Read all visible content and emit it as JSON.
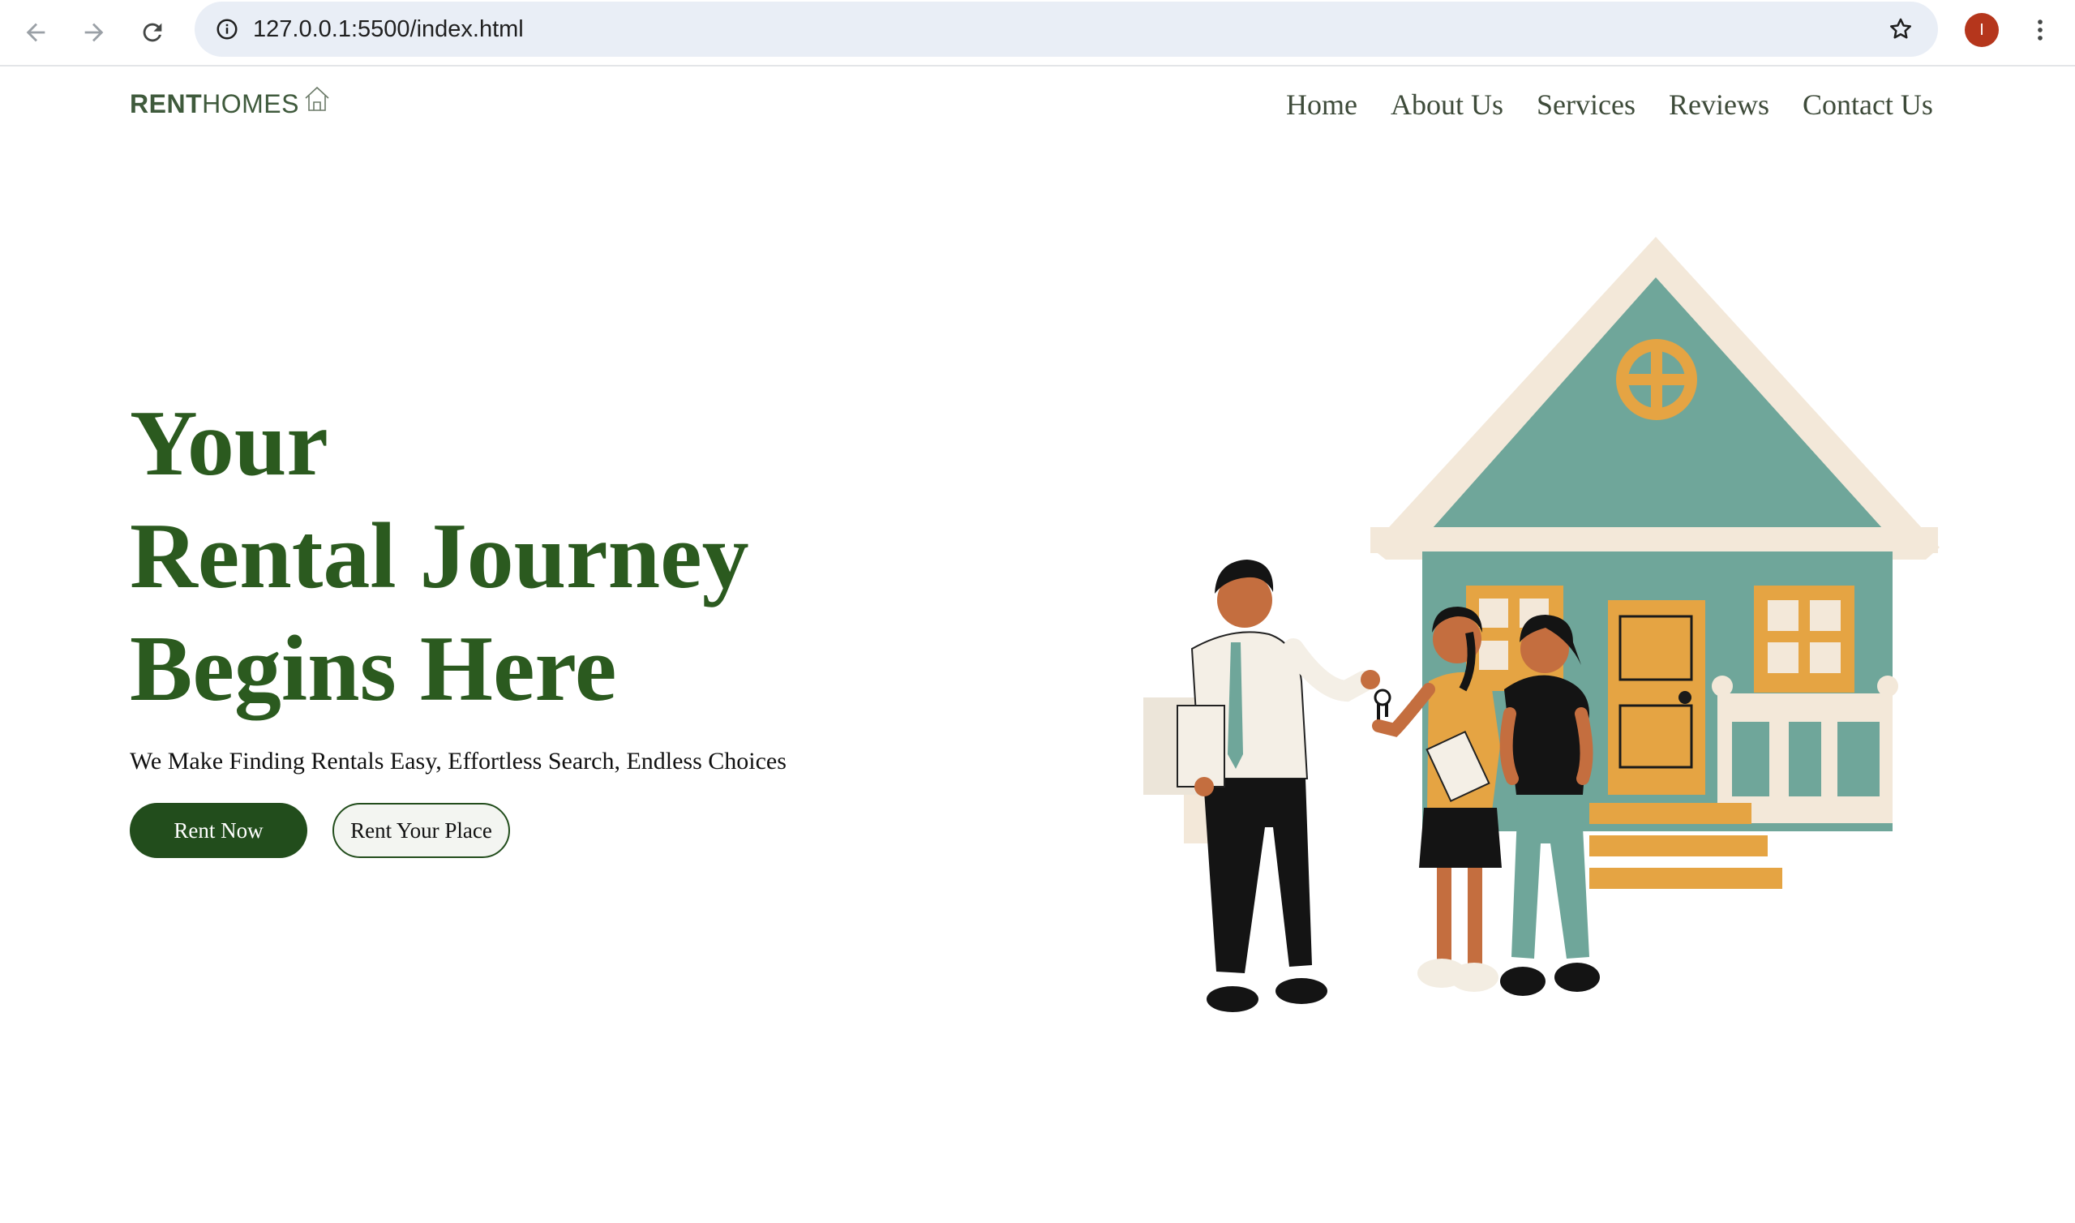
{
  "browser": {
    "url": "127.0.0.1:5500/index.html",
    "profile_initial": "I",
    "icons": [
      "back-arrow-icon",
      "forward-arrow-icon",
      "reload-icon",
      "info-icon",
      "star-icon",
      "more-vert-icon"
    ]
  },
  "site": {
    "logo": {
      "bold": "RENT",
      "regular": "HOMES",
      "icon": "house-outline-icon"
    },
    "nav": [
      "Home",
      "About Us",
      "Services",
      "Reviews",
      "Contact Us"
    ]
  },
  "hero": {
    "title_lines": [
      "Your",
      "Rental Journey",
      "Begins Here"
    ],
    "subtitle": "We Make Finding Rentals Easy, Effortless Search, Endless Choices",
    "primary_button": "Rent Now",
    "secondary_button": "Rent Your Place"
  },
  "colors": {
    "brand_green": "#2b5a1f",
    "button_green": "#224d1c",
    "teal": "#6fa69a",
    "mustard": "#e5a443",
    "cream": "#f3e8d9"
  }
}
